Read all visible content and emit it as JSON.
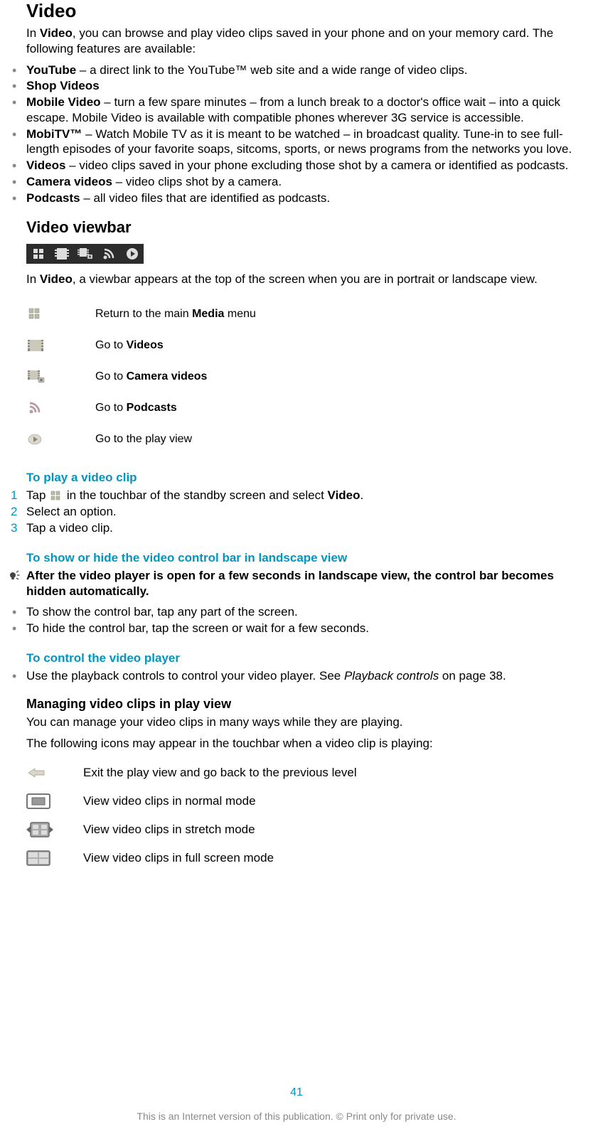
{
  "heading": "Video",
  "intro_parts": [
    "In ",
    "Video",
    ", you can browse and play video clips saved in your phone and on your memory card. The following features are available:"
  ],
  "features": [
    {
      "bold": "YouTube",
      "rest": " – a direct link to the YouTube™ web site and a wide range of video clips."
    },
    {
      "bold": "Shop Videos",
      "rest": ""
    },
    {
      "bold": "Mobile Video",
      "rest": " – turn a few spare minutes – from a lunch break to a doctor's office wait – into a quick escape. Mobile Video is available with compatible phones wherever 3G service is accessible."
    },
    {
      "bold": "MobiTV™",
      "rest": " – Watch Mobile TV as it is meant to be watched – in broadcast quality. Tune-in to see full-length episodes of your favorite soaps, sitcoms, sports, or news programs from the networks you love."
    },
    {
      "bold": "Videos",
      "rest": " – video clips saved in your phone excluding those shot by a camera or identified as podcasts."
    },
    {
      "bold": "Camera videos",
      "rest": " – video clips shot by a camera."
    },
    {
      "bold": "Podcasts",
      "rest": " – all video files that are identified as podcasts."
    }
  ],
  "viewbar_heading": "Video viewbar",
  "viewbar_intro_parts": [
    "In ",
    "Video",
    ", a viewbar appears at the top of the screen when you are in portrait or landscape view."
  ],
  "viewbar_items": [
    {
      "pre": "Return to the main ",
      "bold": "Media",
      "post": " menu"
    },
    {
      "pre": "Go to ",
      "bold": "Videos",
      "post": ""
    },
    {
      "pre": "Go to ",
      "bold": "Camera videos",
      "post": ""
    },
    {
      "pre": "Go to ",
      "bold": "Podcasts",
      "post": ""
    },
    {
      "pre": "Go to the play view",
      "bold": "",
      "post": ""
    }
  ],
  "task_play_heading": "To play a video clip",
  "task_play_steps": [
    {
      "n": "1",
      "pre": "Tap ",
      "post_a": " in the touchbar of the standby screen and select ",
      "bold": "Video",
      "post_b": "."
    },
    {
      "n": "2",
      "text": "Select an option."
    },
    {
      "n": "3",
      "text": "Tap a video clip."
    }
  ],
  "task_controlbar_heading": "To show or hide the video control bar in landscape view",
  "tip_text": "After the video player is open for a few seconds in landscape view, the control bar becomes hidden automatically.",
  "controlbar_bullets": [
    "To show the control bar, tap any part of the screen.",
    "To hide the control bar, tap the screen or wait for a few seconds."
  ],
  "task_controlplayer_heading": "To control the video player",
  "controlplayer_bullet_parts": [
    "Use the playback controls to control your video player. See ",
    "Playback controls",
    " on page 38."
  ],
  "manage_heading": "Managing video clips in play view",
  "manage_p1": "You can manage your video clips in many ways while they are playing.",
  "manage_p2": "The following icons may appear in the touchbar when a video clip is playing:",
  "touchbar_items": [
    "Exit the play view and go back to the previous level",
    "View video clips in normal mode",
    "View video clips in stretch mode",
    "View video clips in full screen mode"
  ],
  "page_number": "41",
  "footer_note": "This is an Internet version of this publication. © Print only for private use."
}
